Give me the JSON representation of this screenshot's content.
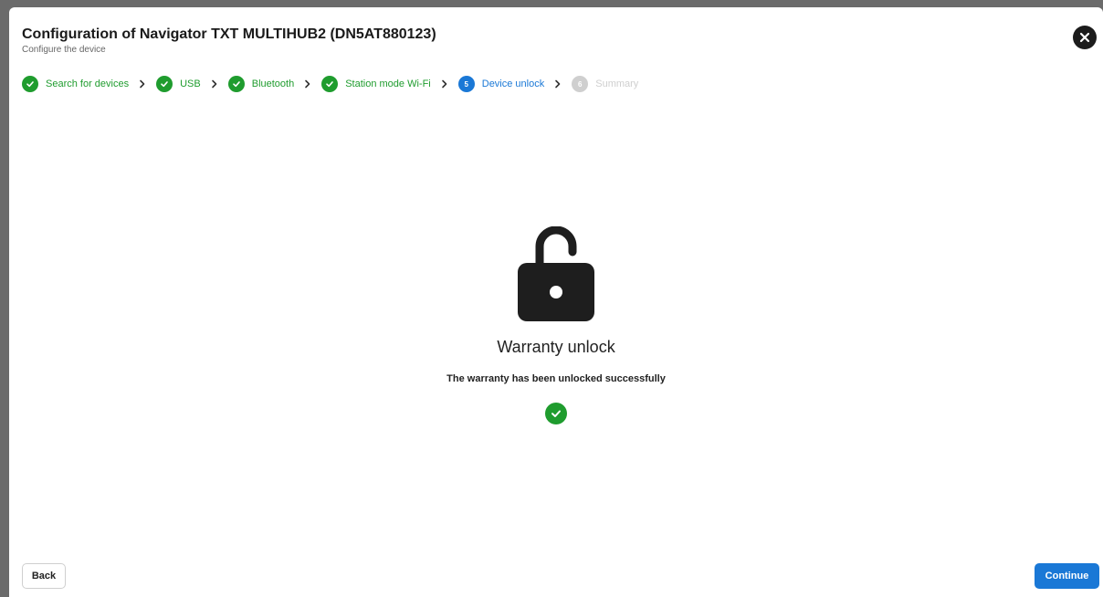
{
  "dialog": {
    "title": "Configuration of Navigator TXT MULTIHUB2 (DN5AT880123)",
    "subtitle": "Configure the device"
  },
  "stepper": {
    "steps": [
      {
        "label": "Search for devices",
        "state": "done"
      },
      {
        "label": "USB",
        "state": "done"
      },
      {
        "label": "Bluetooth",
        "state": "done"
      },
      {
        "label": "Station mode Wi-Fi",
        "state": "done"
      },
      {
        "label": "Device unlock",
        "state": "active",
        "number": "5"
      },
      {
        "label": "Summary",
        "state": "pending",
        "number": "6"
      }
    ]
  },
  "main": {
    "title": "Warranty unlock",
    "message": "The warranty has been unlocked successfully"
  },
  "footer": {
    "back_label": "Back",
    "continue_label": "Continue"
  },
  "colors": {
    "done": "#1f9c2e",
    "active": "#1a78d6",
    "pending": "#cfcfcf"
  },
  "icons": {
    "close": "close-icon",
    "step_done": "check-icon",
    "separator": "chevron-right-icon",
    "lock": "unlocked-padlock-icon",
    "success": "check-circle-icon"
  }
}
